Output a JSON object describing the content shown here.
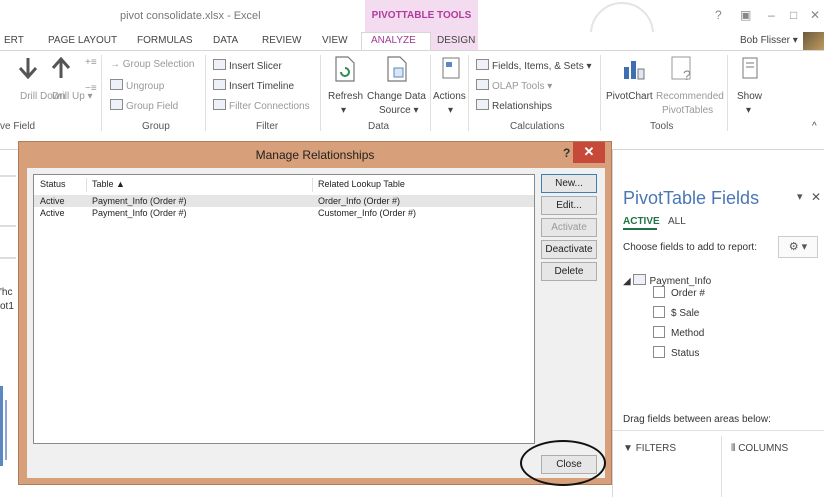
{
  "window": {
    "doc_title": "pivot consolidate.xlsx - Excel",
    "context_title": "PIVOTTABLE TOOLS",
    "help": "?",
    "restore": "▣",
    "minimize": "–",
    "maximize": "□",
    "close": "✕",
    "user": "Bob Flisser ▾"
  },
  "tabs": [
    "ERT",
    "PAGE LAYOUT",
    "FORMULAS",
    "DATA",
    "REVIEW",
    "VIEW",
    "ANALYZE",
    "DESIGN"
  ],
  "ribbon": {
    "active_field": {
      "drill_down": "Drill Down",
      "drill_up": "Drill Up ▾",
      "label": "ve Field"
    },
    "group": {
      "group_selection": "Group Selection",
      "ungroup": "Ungroup",
      "group_field": "Group Field",
      "label": "Group"
    },
    "filter": {
      "insert_slicer": "Insert Slicer",
      "insert_timeline": "Insert Timeline",
      "filter_connections": "Filter Connections",
      "label": "Filter"
    },
    "data": {
      "refresh": "Refresh",
      "refresh_arrow": "▾",
      "change_data_source": "Change Data",
      "change_data_source2": "Source ▾",
      "label": "Data"
    },
    "actions": {
      "label": "Actions",
      "arrow": "▾"
    },
    "calculations": {
      "fields_items": "Fields, Items, & Sets ▾",
      "olap_tools": "OLAP Tools ▾",
      "relationships": "Relationships",
      "label": "Calculations"
    },
    "tools": {
      "pivotchart": "PivotChart",
      "recommended": "Recommended",
      "recommended2": "PivotTables",
      "label": "Tools"
    },
    "show": {
      "label": "Show",
      "arrow": "▾"
    },
    "collapse": "^"
  },
  "sheet": {
    "frag1": "'hc",
    "frag2": "ot1"
  },
  "pane": {
    "title": "PivotTable Fields",
    "options": "▾",
    "close": "✕",
    "tab_active": "ACTIVE",
    "tab_all": "ALL",
    "choose": "Choose fields to add to report:",
    "gear": "⚙ ▾",
    "table_name": "Payment_Info",
    "fields": [
      "Order #",
      "$ Sale",
      "Method",
      "Status"
    ],
    "drag": "Drag fields between areas below:",
    "filters": "FILTERS",
    "columns": "COLUMNS"
  },
  "dialog": {
    "title": "Manage Relationships",
    "help": "?",
    "close": "✕",
    "columns": {
      "status": "Status",
      "table": "Table ▲",
      "related": "Related Lookup Table"
    },
    "rows": [
      {
        "status": "Active",
        "table": "Payment_Info (Order #)",
        "related": "Order_Info (Order #)"
      },
      {
        "status": "Active",
        "table": "Payment_Info (Order #)",
        "related": "Customer_Info (Order #)"
      }
    ],
    "buttons": {
      "new": "New...",
      "edit": "Edit...",
      "activate": "Activate",
      "deactivate": "Deactivate",
      "delete": "Delete",
      "close": "Close"
    }
  }
}
